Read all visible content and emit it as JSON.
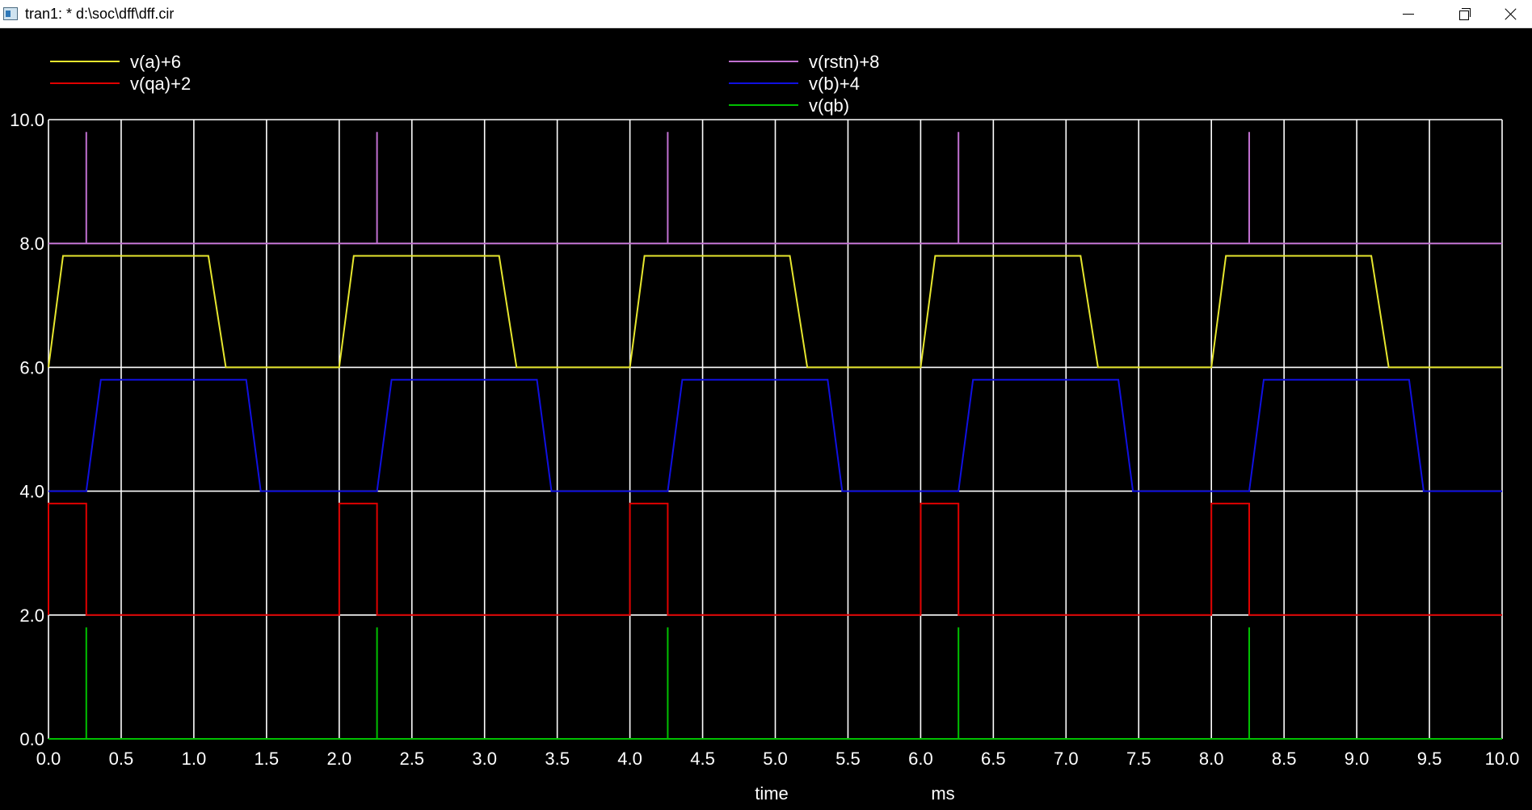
{
  "window": {
    "title": "tran1: * d:\\soc\\dff\\dff.cir"
  },
  "chart_data": {
    "type": "line",
    "xlabel": "time",
    "xunit": "ms",
    "xlim": [
      0.0,
      10.0
    ],
    "ylim": [
      0.0,
      10.0
    ],
    "x_ticks": [
      "0.0",
      "0.5",
      "1.0",
      "1.5",
      "2.0",
      "2.5",
      "3.0",
      "3.5",
      "4.0",
      "4.5",
      "5.0",
      "5.5",
      "6.0",
      "6.5",
      "7.0",
      "7.5",
      "8.0",
      "8.5",
      "9.0",
      "9.5",
      "10.0"
    ],
    "y_ticks": [
      "0.0",
      "2.0",
      "4.0",
      "6.0",
      "8.0",
      "10.0"
    ],
    "grid": true,
    "legend": "top",
    "colors": {
      "background": "#000000",
      "grid": "#ffffff",
      "text": "#ffffff"
    },
    "series": [
      {
        "name": "v(a)+6",
        "color": "#e6e62e",
        "x": [
          0.0,
          0.1,
          0.12,
          1.1,
          1.22,
          2.0,
          2.1,
          2.12,
          3.1,
          3.22,
          4.0,
          4.1,
          4.12,
          5.1,
          5.22,
          6.0,
          6.1,
          6.12,
          7.1,
          7.22,
          8.0,
          8.1,
          8.12,
          9.1,
          9.22,
          10.0
        ],
        "y": [
          6.0,
          7.8,
          7.8,
          7.8,
          6.0,
          6.0,
          7.8,
          7.8,
          7.8,
          6.0,
          6.0,
          7.8,
          7.8,
          7.8,
          6.0,
          6.0,
          7.8,
          7.8,
          7.8,
          6.0,
          6.0,
          7.8,
          7.8,
          7.8,
          6.0,
          6.0
        ]
      },
      {
        "name": "v(qa)+2",
        "color": "#e00000",
        "x": [
          0.0,
          0.0,
          0.26,
          0.26,
          2.0,
          2.0,
          2.26,
          2.26,
          4.0,
          4.0,
          4.26,
          4.26,
          6.0,
          6.0,
          6.26,
          6.26,
          8.0,
          8.0,
          8.26,
          8.26,
          10.0
        ],
        "y": [
          2.0,
          3.8,
          3.8,
          2.0,
          2.0,
          3.8,
          3.8,
          2.0,
          2.0,
          3.8,
          3.8,
          2.0,
          2.0,
          3.8,
          3.8,
          2.0,
          2.0,
          3.8,
          3.8,
          2.0,
          2.0
        ]
      },
      {
        "name": "v(rstn)+8",
        "color": "#c070d0",
        "x": [
          0.0,
          0.26,
          0.26,
          0.26,
          2.26,
          2.26,
          2.26,
          4.26,
          4.26,
          4.26,
          6.26,
          6.26,
          6.26,
          8.26,
          8.26,
          8.26,
          10.0
        ],
        "y": [
          8.0,
          8.0,
          9.8,
          8.0,
          8.0,
          9.8,
          8.0,
          8.0,
          9.8,
          8.0,
          8.0,
          9.8,
          8.0,
          8.0,
          9.8,
          8.0,
          8.0
        ]
      },
      {
        "name": "v(b)+4",
        "color": "#1010e0",
        "x": [
          0.0,
          0.26,
          0.36,
          0.38,
          1.36,
          1.46,
          2.26,
          2.36,
          2.38,
          3.36,
          3.46,
          4.26,
          4.36,
          4.38,
          5.36,
          5.46,
          6.26,
          6.36,
          6.38,
          7.36,
          7.46,
          8.26,
          8.36,
          8.38,
          9.36,
          9.46,
          10.0
        ],
        "y": [
          4.0,
          4.0,
          5.8,
          5.8,
          5.8,
          4.0,
          4.0,
          5.8,
          5.8,
          5.8,
          4.0,
          4.0,
          5.8,
          5.8,
          5.8,
          4.0,
          4.0,
          5.8,
          5.8,
          5.8,
          4.0,
          4.0,
          5.8,
          5.8,
          5.8,
          4.0,
          4.0
        ]
      },
      {
        "name": "v(qb)",
        "color": "#00c000",
        "x": [
          0.0,
          0.26,
          0.26,
          0.26,
          2.26,
          2.26,
          2.26,
          4.26,
          4.26,
          4.26,
          6.26,
          6.26,
          6.26,
          8.26,
          8.26,
          8.26,
          10.0
        ],
        "y": [
          0.0,
          0.0,
          1.8,
          0.0,
          0.0,
          1.8,
          0.0,
          0.0,
          1.8,
          0.0,
          0.0,
          1.8,
          0.0,
          0.0,
          1.8,
          0.0,
          0.0
        ]
      }
    ]
  }
}
